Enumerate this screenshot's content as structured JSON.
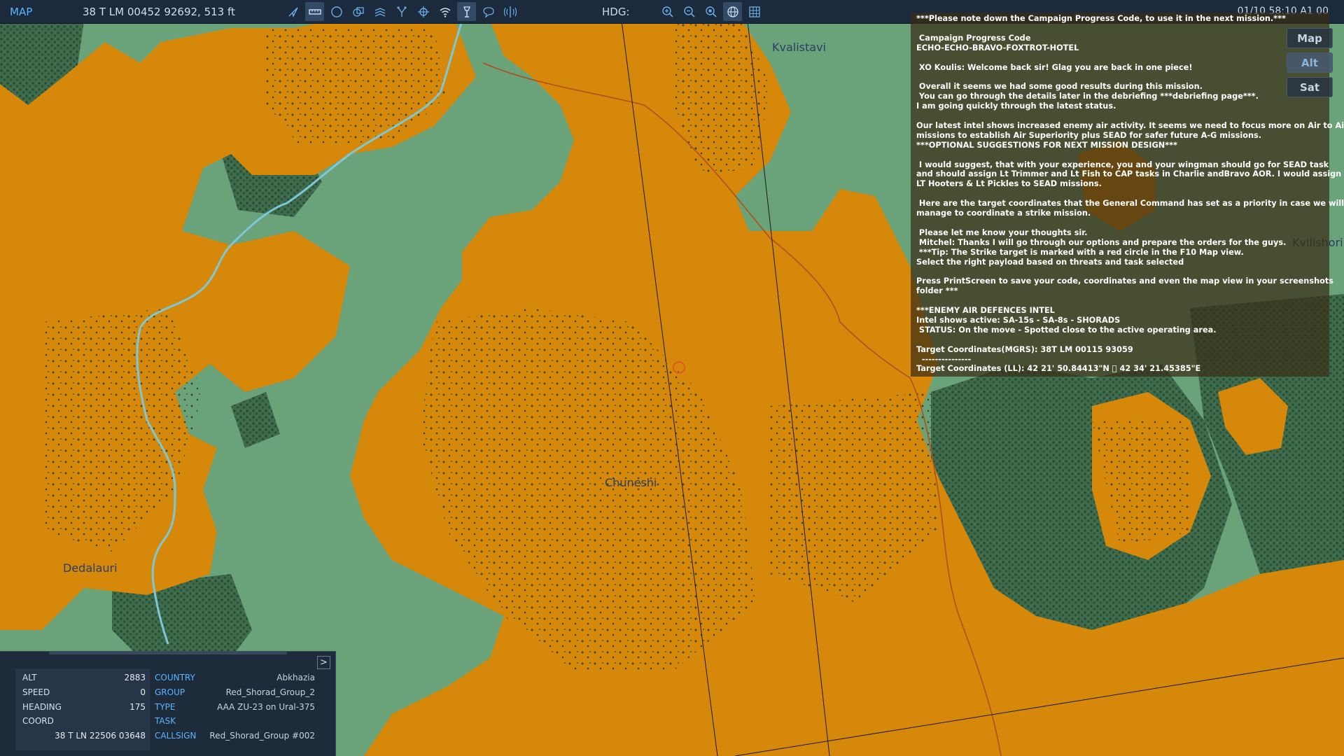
{
  "window": {
    "mode_label": "MAP"
  },
  "topbar": {
    "cursor_coordinate": "38 T LM 00452 92692, 513 ft",
    "heading_label": "HDG:",
    "clock": "01/10 58:10 A1 00",
    "left_tools": [
      {
        "icon": "arrow-cursor-icon",
        "active": false
      },
      {
        "icon": "ruler-icon",
        "active": true
      },
      {
        "icon": "circle-icon",
        "active": false
      },
      {
        "icon": "layers-icon",
        "active": false
      },
      {
        "icon": "stack-icon",
        "active": false
      },
      {
        "icon": "route-icon",
        "active": false
      },
      {
        "icon": "crosshair-icon",
        "active": false
      },
      {
        "icon": "wifi-icon",
        "active": false
      },
      {
        "icon": "lamp-icon",
        "active": true
      },
      {
        "icon": "chat-bubble-icon",
        "active": false
      },
      {
        "icon": "antenna-icon",
        "active": false
      }
    ],
    "right_tools": [
      {
        "icon": "zoom-in-icon"
      },
      {
        "icon": "zoom-out-icon"
      },
      {
        "icon": "zoom-fit-icon"
      },
      {
        "icon": "globe-icon"
      },
      {
        "icon": "grid-icon"
      }
    ]
  },
  "map_layers": [
    {
      "label": "Map",
      "active": false
    },
    {
      "label": "Alt",
      "active": true
    },
    {
      "label": "Sat",
      "active": false
    }
  ],
  "map": {
    "colors": {
      "lowland": "#6aa27a",
      "urban": "#d6880a",
      "forest": "#39674a",
      "river": "#7cc8d8",
      "road": "#b0501c"
    },
    "places": [
      {
        "name": "Kvalistavi"
      },
      {
        "name": "Chuneshi"
      },
      {
        "name": "Dedalauri"
      },
      {
        "name": "Kvilishori"
      }
    ]
  },
  "mission_message": {
    "lines": [
      "***Please note down the Campaign Progress Code, to use it in the next mission.***",
      "",
      " Campaign Progress Code",
      "ECHO-ECHO-BRAVO-FOXTROT-HOTEL",
      "",
      " XO Koulis: Welcome back sir! Glag you are back in one piece!",
      "",
      " Overall it seems we had some good results during this mission.",
      " You can go through the details later in the debriefing ***debriefing page***.",
      "I am going quickly through the latest status.",
      "",
      "Our latest intel shows increased enemy air activity. It seems we need to focus more on Air to Air",
      "missions to establish Air Superiority plus SEAD for safer future A-G missions.",
      "***OPTIONAL SUGGESTIONS FOR NEXT MISSION DESIGN***",
      "",
      " I would suggest, that with your experience, you and your wingman should go for SEAD task",
      "and should assign Lt Trimmer and Lt Fish to CAP tasks in Charlie andBravo AOR. I would assign",
      "LT Hooters & Lt Pickles to SEAD missions.",
      "",
      " Here are the target coordinates that the General Command has set as a priority in case we will",
      "manage to coordinate a strike mission.",
      "",
      " Please let me know your thoughts sir.",
      " Mitchel: Thanks I will go through our options and prepare the orders for the guys.",
      " ***Tip: The Strike target is marked with a red circle in the F10 Map view.",
      "Select the right payload based on threats and task selected",
      "",
      "Press PrintScreen to save your code, coordinates and even the map view in your screenshots",
      "folder ***",
      "",
      "***ENEMY AIR DEFENCES INTEL",
      "Intel shows active: SA-15s - SA-8s - SHORADS",
      " STATUS: On the move - Spotted close to the active operating area.",
      "",
      "Target Coordinates(MGRS): 38T LM 00115 93059",
      "  ---------------",
      "Target Coordinates (LL): 42 21' 50.84413\"N ⃞ 42 34' 21.45385\"E"
    ]
  },
  "unit_info": {
    "expand_label": ">",
    "left": [
      {
        "key": "ALT",
        "value": "2883"
      },
      {
        "key": "SPEED",
        "value": "0"
      },
      {
        "key": "HEADING",
        "value": "175"
      },
      {
        "key": "COORD",
        "value": ""
      },
      {
        "key": "",
        "value": "38 T LN 22506 03648"
      }
    ],
    "right": [
      {
        "key": "COUNTRY",
        "value": "Abkhazia"
      },
      {
        "key": "GROUP",
        "value": "Red_Shorad_Group_2"
      },
      {
        "key": "TYPE",
        "value": "AAA ZU-23 on Ural-375"
      },
      {
        "key": "TASK",
        "value": ""
      },
      {
        "key": "CALLSIGN",
        "value": "Red_Shorad_Group #002"
      }
    ]
  }
}
